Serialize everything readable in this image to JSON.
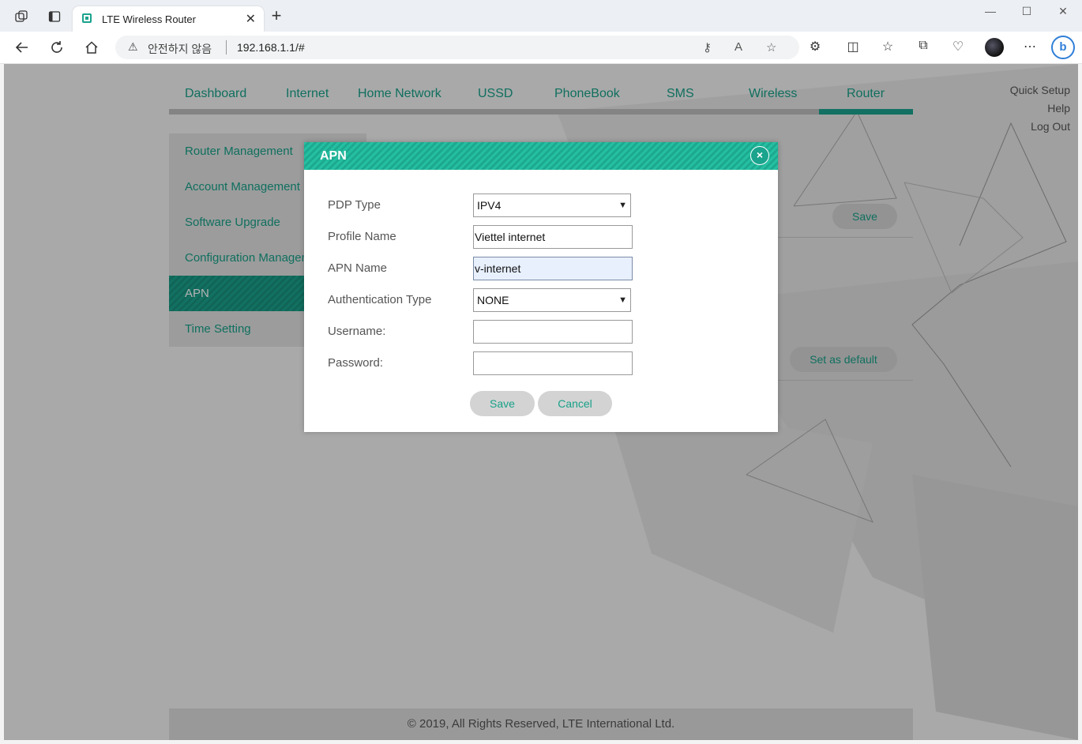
{
  "browser": {
    "tab_title": "LTE Wireless Router",
    "security_label": "안전하지 않음",
    "url": "192.168.1.1/#"
  },
  "nav": {
    "items": [
      "Dashboard",
      "Internet",
      "Home Network",
      "USSD",
      "PhoneBook",
      "SMS",
      "Wireless",
      "Router"
    ],
    "active": "Router"
  },
  "top_links": {
    "quick_setup": "Quick Setup",
    "help": "Help",
    "logout": "Log Out"
  },
  "sidebar": {
    "items": [
      "Router Management",
      "Account Management",
      "Software Upgrade",
      "Configuration Management",
      "APN",
      "Time Setting"
    ],
    "active": "APN"
  },
  "background": {
    "save_label": "Save",
    "set_default_label": "Set as default"
  },
  "modal": {
    "title": "APN",
    "fields": {
      "pdp_type": {
        "label": "PDP Type",
        "value": "IPV4"
      },
      "profile_name": {
        "label": "Profile Name",
        "value": "Viettel internet"
      },
      "apn_name": {
        "label": "APN Name",
        "value": "v-internet"
      },
      "auth_type": {
        "label": "Authentication Type",
        "value": "NONE"
      },
      "username": {
        "label": "Username:",
        "value": ""
      },
      "password": {
        "label": "Password:",
        "value": ""
      }
    },
    "save_label": "Save",
    "cancel_label": "Cancel"
  },
  "footer": {
    "text": "© 2019, All Rights Reserved, LTE International Ltd."
  },
  "colors": {
    "accent": "#1aa38d",
    "header_stripe": "#25bfa2"
  }
}
